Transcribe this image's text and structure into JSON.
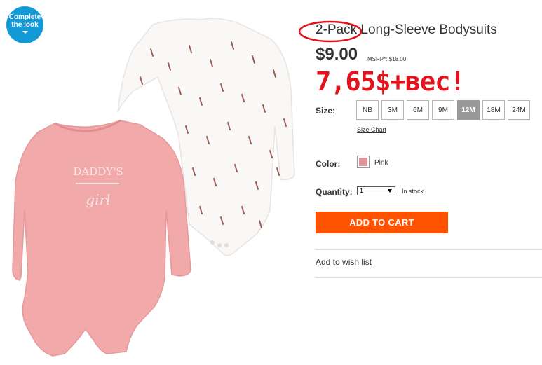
{
  "badge": {
    "line1": "Complete",
    "line2": "the look"
  },
  "product": {
    "title": "2-Pack Long-Sleeve Bodysuits",
    "price": "$9.00",
    "msrp": "MSRP*: $18.00",
    "promo_annotation": "7,65$+вес!",
    "image_text": {
      "line1": "DADDY'S",
      "line2": "girl"
    }
  },
  "size": {
    "label": "Size:",
    "options": [
      "NB",
      "3M",
      "6M",
      "9M",
      "12M",
      "18M",
      "24M"
    ],
    "selected": "12M",
    "chart_link": "Size Chart"
  },
  "color": {
    "label": "Color:",
    "value": "Pink",
    "swatch": "#e0949a"
  },
  "quantity": {
    "label": "Quantity:",
    "value": "1",
    "stock": "In stock"
  },
  "actions": {
    "add_to_cart": "ADD TO CART",
    "wish_list": "Add to wish list"
  },
  "colors": {
    "accent": "#ff5200",
    "badge": "#139ad6",
    "promo": "#e2131c"
  }
}
